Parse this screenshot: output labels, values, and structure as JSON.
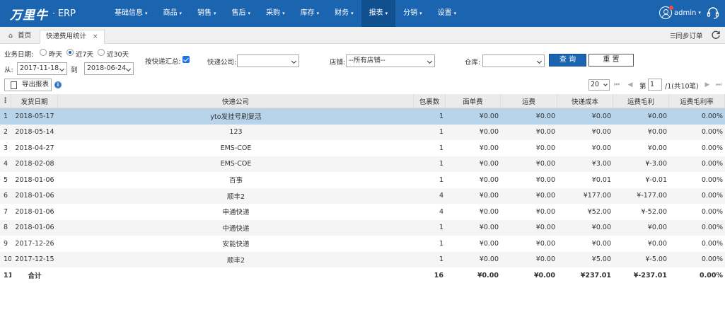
{
  "brand": {
    "logo_text": "万里牛",
    "dot": "·",
    "product": "ERP"
  },
  "nav": [
    {
      "label": "基础信息",
      "caret": true
    },
    {
      "label": "商品",
      "caret": true
    },
    {
      "label": "销售",
      "caret": true
    },
    {
      "label": "售后",
      "caret": true
    },
    {
      "label": "采购",
      "caret": true
    },
    {
      "label": "库存",
      "caret": true
    },
    {
      "label": "财务",
      "caret": true
    },
    {
      "label": "报表",
      "caret": true,
      "active": true
    },
    {
      "label": "分销",
      "caret": true
    },
    {
      "label": "设置",
      "caret": true
    }
  ],
  "user": {
    "name": "admin"
  },
  "tabs": {
    "home": "首页",
    "active": "快递费用统计",
    "close": "×"
  },
  "sync_label": "同步订单",
  "filters": {
    "date_label": "业务日期:",
    "quick": [
      "昨天",
      "近7天",
      "近30天"
    ],
    "quick_selected": "近7天",
    "from_label": "从:",
    "from_value": "2017-11-18",
    "to_label": "到",
    "to_value": "2018-06-24",
    "group_label": "按快递汇总:",
    "group_checked": true,
    "courier_label": "快递公司:",
    "courier_value": "",
    "shop_label": "店铺:",
    "shop_value": "--所有店铺--",
    "warehouse_label": "仓库:",
    "warehouse_value": "",
    "query_button": "查 询",
    "reset_button": "重 置"
  },
  "export_button": "导出报表",
  "pager": {
    "page_size": "20",
    "page_label": "第",
    "page": "1",
    "total": "/1(共10笔)"
  },
  "columns": [
    "发货日期",
    "快递公司",
    "包裹数",
    "面单费",
    "运费",
    "快递成本",
    "运费毛利",
    "运费毛利率"
  ],
  "rows": [
    {
      "n": "1",
      "date": "2018-05-17",
      "co": "yto发挂号刷复活",
      "pkg": "1",
      "m1": "¥0.00",
      "m2": "¥0.00",
      "m3": "¥0.00",
      "m4": "¥0.00",
      "m5": "0.00%"
    },
    {
      "n": "2",
      "date": "2018-05-14",
      "co": "123",
      "pkg": "1",
      "m1": "¥0.00",
      "m2": "¥0.00",
      "m3": "¥0.00",
      "m4": "¥0.00",
      "m5": "0.00%"
    },
    {
      "n": "3",
      "date": "2018-04-27",
      "co": "EMS-COE",
      "pkg": "1",
      "m1": "¥0.00",
      "m2": "¥0.00",
      "m3": "¥0.00",
      "m4": "¥0.00",
      "m5": "0.00%"
    },
    {
      "n": "4",
      "date": "2018-02-08",
      "co": "EMS-COE",
      "pkg": "1",
      "m1": "¥0.00",
      "m2": "¥0.00",
      "m3": "¥3.00",
      "m4": "¥-3.00",
      "m5": "0.00%"
    },
    {
      "n": "5",
      "date": "2018-01-06",
      "co": "百事",
      "pkg": "1",
      "m1": "¥0.00",
      "m2": "¥0.00",
      "m3": "¥0.01",
      "m4": "¥-0.01",
      "m5": "0.00%"
    },
    {
      "n": "6",
      "date": "2018-01-06",
      "co": "顺丰2",
      "pkg": "4",
      "m1": "¥0.00",
      "m2": "¥0.00",
      "m3": "¥177.00",
      "m4": "¥-177.00",
      "m5": "0.00%"
    },
    {
      "n": "7",
      "date": "2018-01-06",
      "co": "申通快递",
      "pkg": "4",
      "m1": "¥0.00",
      "m2": "¥0.00",
      "m3": "¥52.00",
      "m4": "¥-52.00",
      "m5": "0.00%"
    },
    {
      "n": "8",
      "date": "2018-01-06",
      "co": "中通快递",
      "pkg": "1",
      "m1": "¥0.00",
      "m2": "¥0.00",
      "m3": "¥0.00",
      "m4": "¥0.00",
      "m5": "0.00%"
    },
    {
      "n": "9",
      "date": "2017-12-26",
      "co": "安能快递",
      "pkg": "1",
      "m1": "¥0.00",
      "m2": "¥0.00",
      "m3": "¥0.00",
      "m4": "¥0.00",
      "m5": "0.00%"
    },
    {
      "n": "10",
      "date": "2017-12-15",
      "co": "顺丰2",
      "pkg": "1",
      "m1": "¥0.00",
      "m2": "¥0.00",
      "m3": "¥5.00",
      "m4": "¥-5.00",
      "m5": "0.00%"
    }
  ],
  "total": {
    "n": "11",
    "label": "合计",
    "pkg": "16",
    "m1": "¥0.00",
    "m2": "¥0.00",
    "m3": "¥237.01",
    "m4": "¥-237.01",
    "m5": "0.00%"
  },
  "colors": {
    "topbar": "#1b64b0",
    "nav_active": "#10508f",
    "selected_row": "#b8d4ea"
  }
}
